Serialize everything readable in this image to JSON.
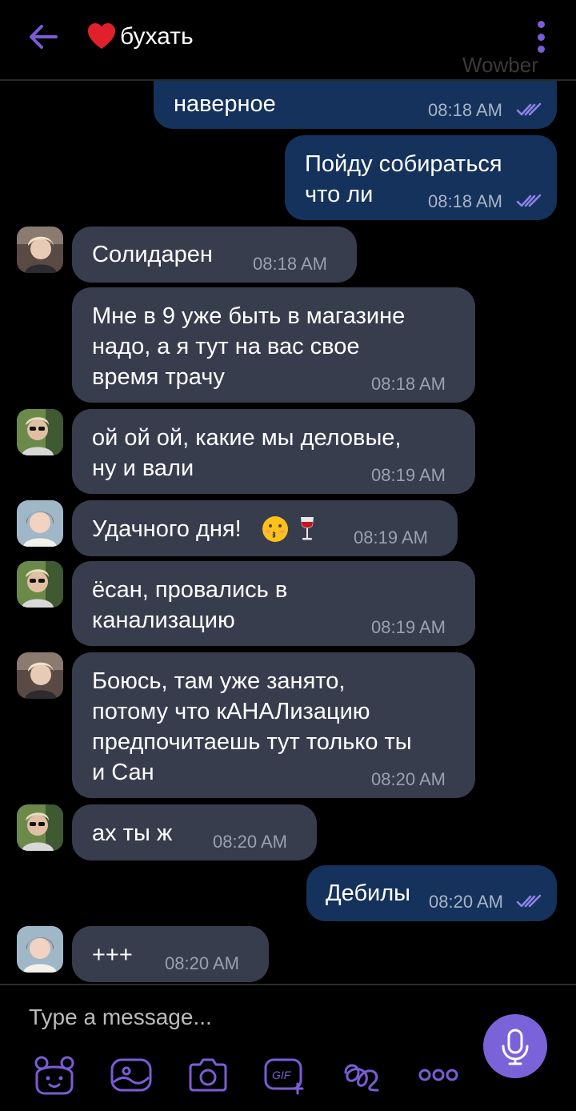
{
  "header": {
    "title": "бухать",
    "watermark": "Wowber"
  },
  "messages": [
    {
      "direction": "out",
      "text": "наверное",
      "time": "08:18 AM",
      "status": "read"
    },
    {
      "direction": "out",
      "text": "Пойду собираться\nчто ли",
      "time": "08:18 AM",
      "status": "read"
    },
    {
      "direction": "in",
      "text": "Солидарен",
      "time": "08:18 AM",
      "avatar": "avatar-blond"
    },
    {
      "direction": "in",
      "text": "Мне в 9 уже быть в магазине\nнадо, а я тут на вас свое\nвремя трачу",
      "time": "08:18 AM"
    },
    {
      "direction": "in",
      "text": "ой ой ой, какие мы деловые,\nну и вали",
      "time": "08:19 AM",
      "avatar": "avatar-sunglasses"
    },
    {
      "direction": "in",
      "text": "Удачного дня!",
      "time": "08:19 AM",
      "avatar": "avatar-girl",
      "emoji": [
        "kissing-face",
        "wine-glass"
      ]
    },
    {
      "direction": "in",
      "text": "ёсан, провались в\nканализацию",
      "time": "08:19 AM",
      "avatar": "avatar-sunglasses"
    },
    {
      "direction": "in",
      "text": "Боюсь, там уже занято,\nпотому что  кАНАЛизацию\nпредпочитаешь тут только ты\nи Сан",
      "time": "08:20 AM",
      "avatar": "avatar-blond"
    },
    {
      "direction": "in",
      "text": "ах ты ж",
      "time": "08:20 AM",
      "avatar": "avatar-sunglasses"
    },
    {
      "direction": "out",
      "text": "Дебилы",
      "time": "08:20 AM",
      "status": "read"
    },
    {
      "direction": "in",
      "text": "+++",
      "time": "08:20 AM",
      "avatar": "avatar-girl"
    }
  ],
  "composer": {
    "placeholder": "Type a message...",
    "tools": [
      "sticker-bear-icon",
      "image-icon",
      "camera-icon",
      "gif-icon",
      "doodle-icon",
      "more-icon"
    ],
    "mic": "microphone-icon"
  },
  "colors": {
    "accent": "#7b5cd6",
    "outgoing_bubble": "#14325b",
    "incoming_bubble": "#383d4e",
    "background": "#000000",
    "time_text": "#9aa0b0"
  }
}
